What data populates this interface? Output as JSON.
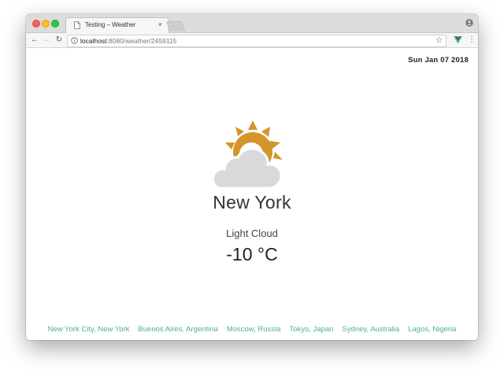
{
  "browser": {
    "tab_title": "Testing – Weather",
    "tab_close": "×",
    "url_host": "localhost",
    "url_rest": ":8080/weather/2459115"
  },
  "icons": {
    "document": "document-icon",
    "close": "close-icon",
    "profile": "profile-icon",
    "back": "back-arrow-icon",
    "forward": "forward-arrow-icon",
    "reload": "reload-icon",
    "info": "info-icon",
    "star": "star-icon",
    "vue": "vue-devtools-icon",
    "menu": "menu-icon",
    "weather": "light-cloud-icon"
  },
  "glyphs": {
    "back": "←",
    "forward": "→",
    "reload": "↻",
    "star": "☆",
    "menu": "⋮"
  },
  "colors": {
    "link": "#4fb08c",
    "sun": "#d4952b",
    "cloud": "#d9d9d9",
    "vue_green": "#41b883",
    "vue_dark": "#35495e"
  },
  "page": {
    "date": "Sun Jan 07 2018",
    "city": "New York",
    "condition": "Light Cloud",
    "temperature": "-10 °C"
  },
  "city_links": [
    "New York City, New York",
    "Buenos Aires, Argentina",
    "Moscow, Russia",
    "Tokyo, Japan",
    "Sydney, Australia",
    "Lagos, Nigeria"
  ]
}
